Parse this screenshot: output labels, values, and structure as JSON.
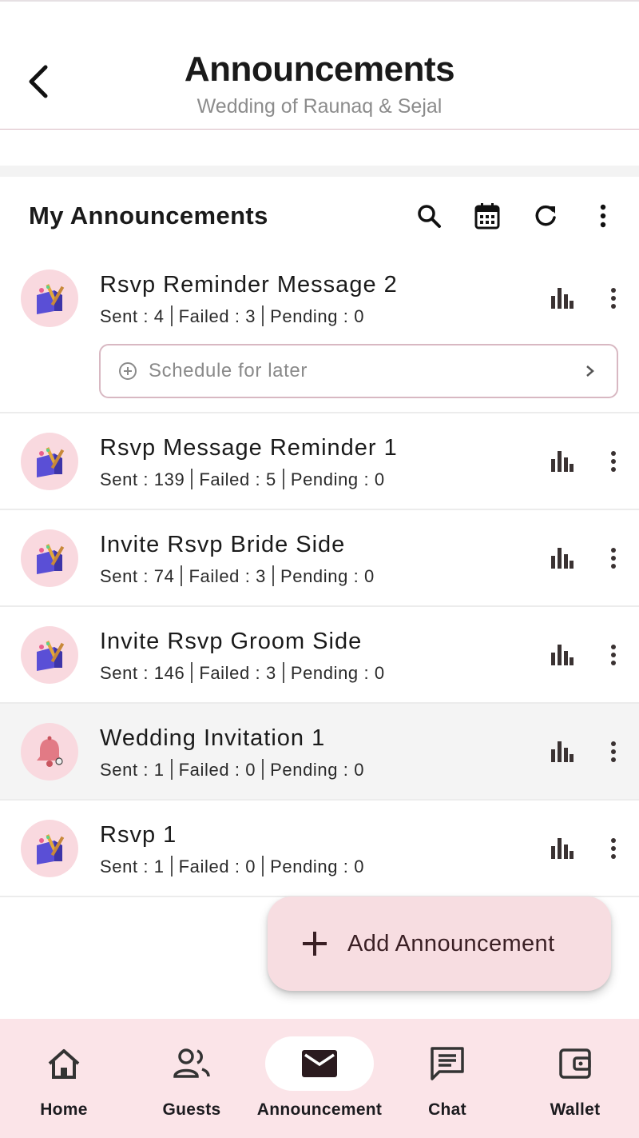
{
  "header": {
    "title": "Announcements",
    "subtitle": "Wedding of Raunaq & Sejal",
    "back_icon": "back-arrow-icon"
  },
  "section": {
    "title": "My Announcements",
    "actions": [
      "search-icon",
      "calendar-icon",
      "refresh-icon",
      "more-vertical-icon"
    ]
  },
  "announcements": [
    {
      "title": "Rsvp Reminder Message 2",
      "sent": "Sent : 4",
      "failed": "Failed : 3",
      "pending": "Pending : 0",
      "avatar": "gift-icon",
      "schedule_label": "Schedule for later"
    },
    {
      "title": "Rsvp Message Reminder 1",
      "sent": "Sent : 139",
      "failed": "Failed : 5",
      "pending": "Pending : 0",
      "avatar": "gift-icon"
    },
    {
      "title": "Invite Rsvp Bride Side",
      "sent": "Sent : 74",
      "failed": "Failed : 3",
      "pending": "Pending : 0",
      "avatar": "gift-icon"
    },
    {
      "title": "Invite Rsvp Groom Side",
      "sent": "Sent : 146",
      "failed": "Failed : 3",
      "pending": "Pending : 0",
      "avatar": "gift-icon"
    },
    {
      "title": "Wedding Invitation 1",
      "sent": "Sent : 1",
      "failed": "Failed : 0",
      "pending": "Pending : 0",
      "avatar": "bell-icon"
    },
    {
      "title": "Rsvp 1",
      "sent": "Sent : 1",
      "failed": "Failed : 0",
      "pending": "Pending : 0",
      "avatar": "gift-icon"
    }
  ],
  "fab": {
    "label": "Add Announcement",
    "icon": "plus-icon"
  },
  "nav": {
    "items": [
      {
        "label": "Home",
        "icon": "home-icon"
      },
      {
        "label": "Guests",
        "icon": "guests-icon"
      },
      {
        "label": "Announcement",
        "icon": "mail-icon",
        "active": true
      },
      {
        "label": "Chat",
        "icon": "chat-icon"
      },
      {
        "label": "Wallet",
        "icon": "wallet-icon"
      }
    ]
  },
  "colors": {
    "accent": "#f7dde1",
    "nav_background": "#fbe4e8",
    "avatar_background": "#f9d9df",
    "divider": "#d8b8c2"
  }
}
